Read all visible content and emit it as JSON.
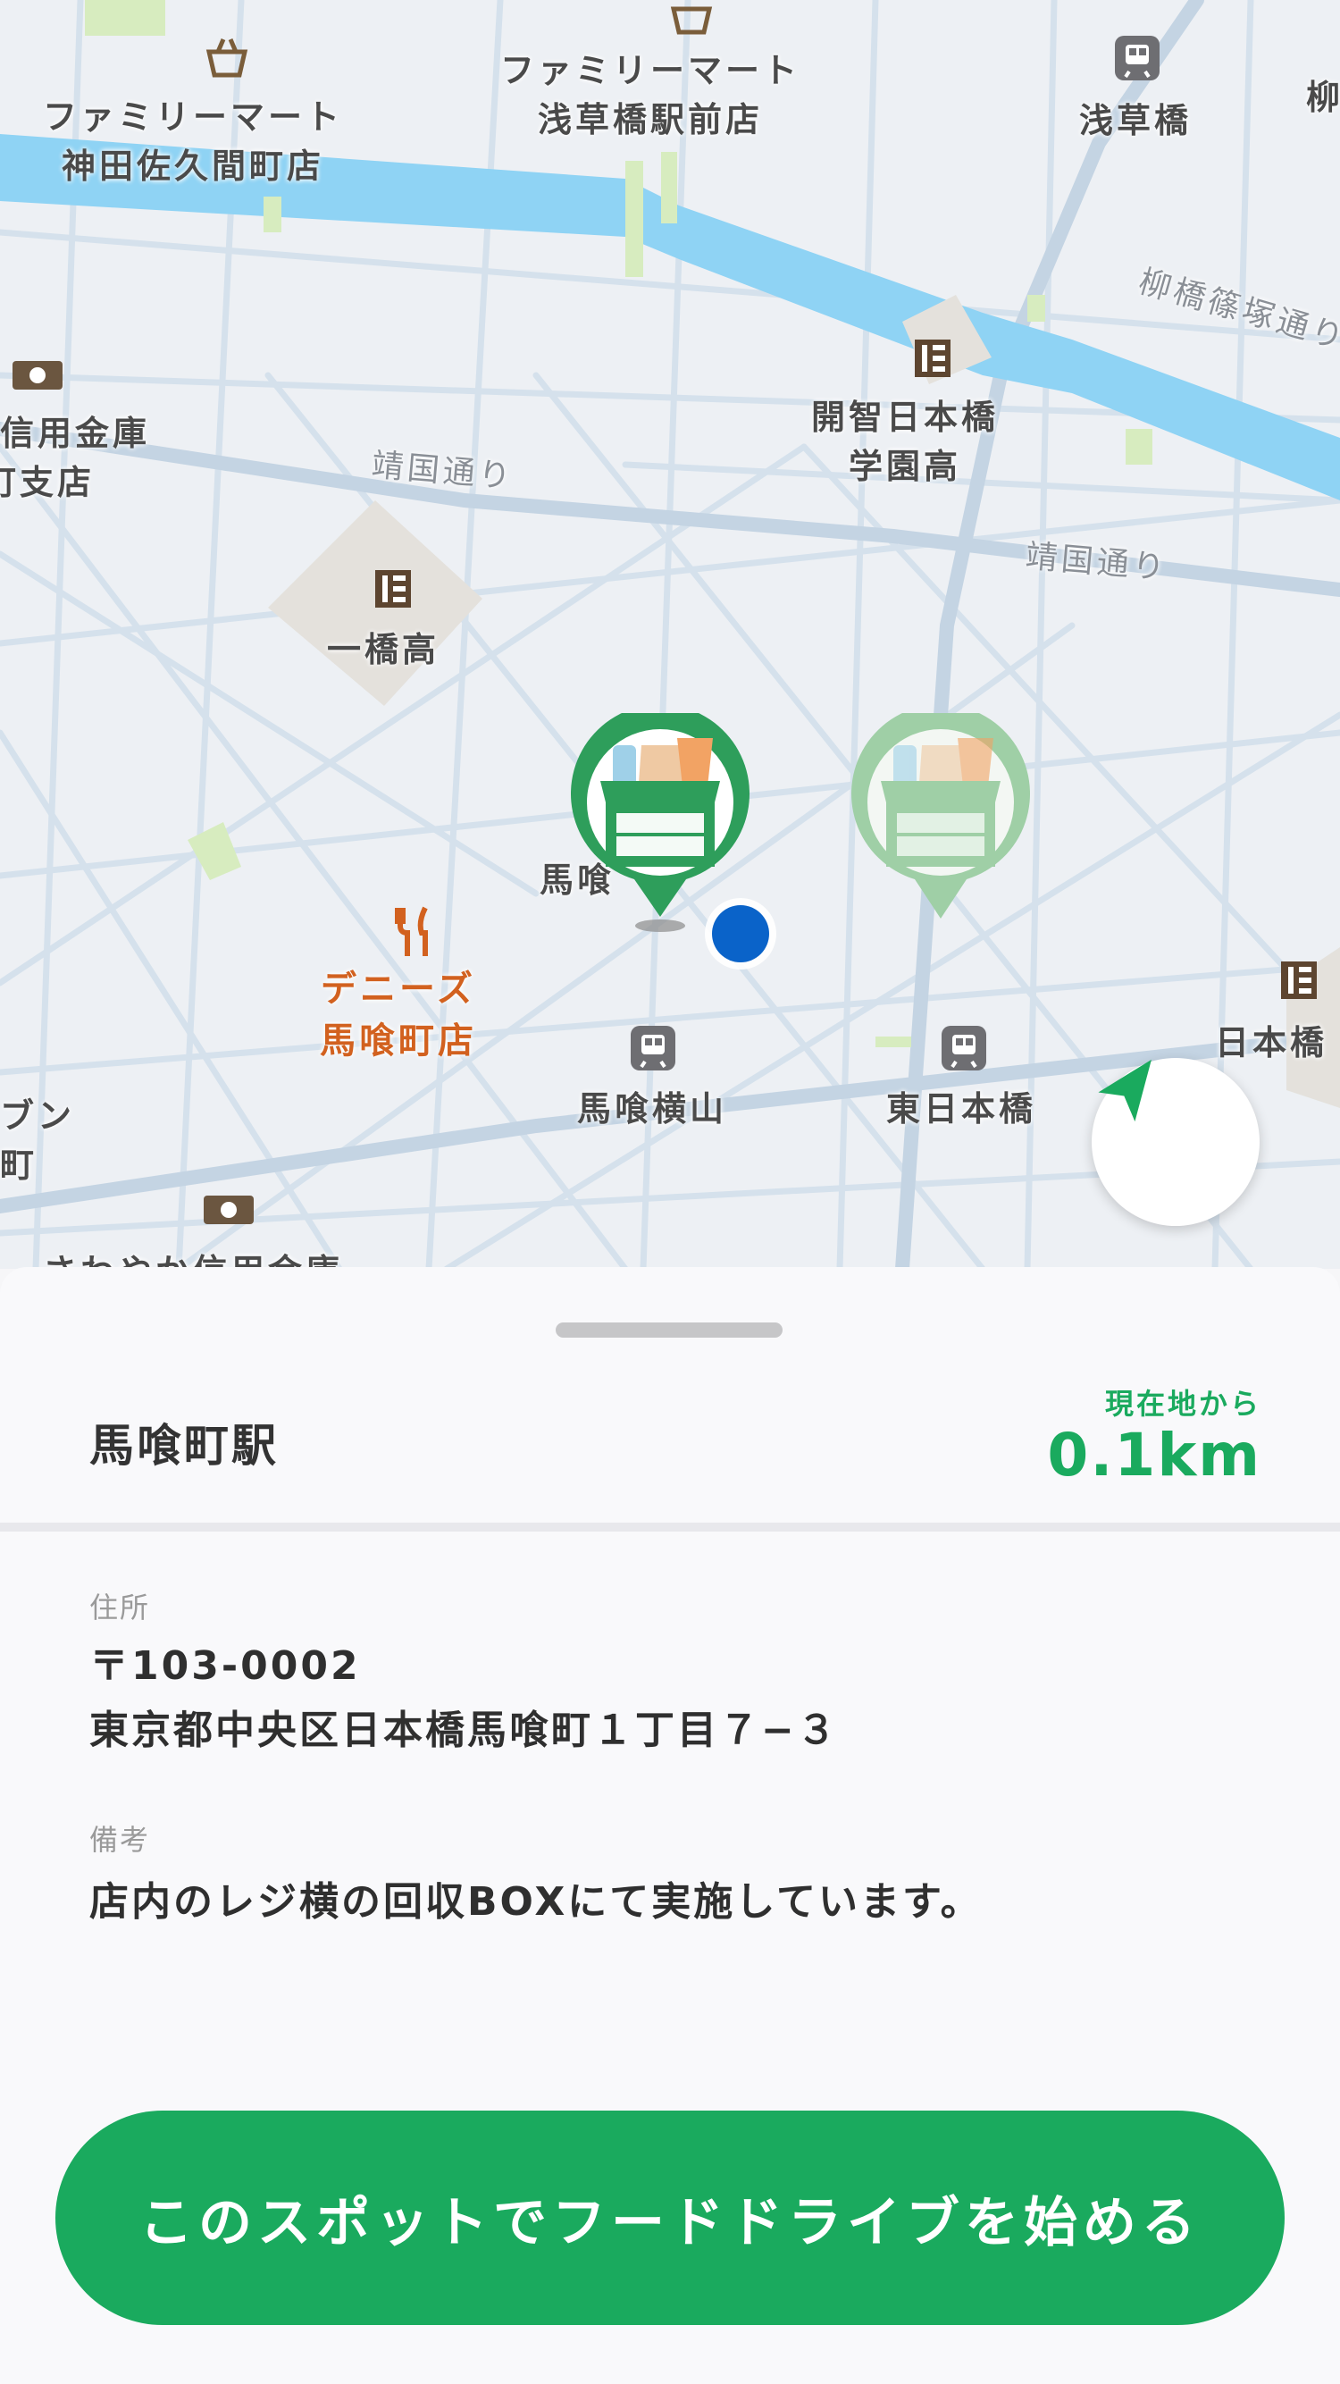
{
  "map": {
    "poi_labels": [
      {
        "id": "familymart-kanda",
        "lines": [
          "ファミリーマート",
          "神田佐久間町店"
        ]
      },
      {
        "id": "familymart-asakusabashi",
        "lines": [
          "ファミリーマート",
          "浅草橋駅前店"
        ]
      },
      {
        "id": "asakusabashi-station",
        "lines": [
          "浅草橋"
        ]
      },
      {
        "id": "bank-left",
        "lines": [
          "信用金庫",
          "町支店"
        ]
      },
      {
        "id": "kaichi-school",
        "lines": [
          "開智日本橋",
          "学園高"
        ]
      },
      {
        "id": "hitotsubashi-school",
        "lines": [
          "一橋高"
        ]
      },
      {
        "id": "bakurocho-partial",
        "lines": [
          "馬喰"
        ]
      },
      {
        "id": "bakuroyokoyama-station",
        "lines": [
          "馬喰横山"
        ]
      },
      {
        "id": "higashinihombashi-station",
        "lines": [
          "東日本橋"
        ]
      },
      {
        "id": "nihombashi-right",
        "lines": [
          "日本橋"
        ]
      },
      {
        "id": "left-edge-partial",
        "lines": [
          "ブン",
          "町"
        ]
      },
      {
        "id": "sawayaka-bank",
        "lines": [
          "さわやか信用金庫"
        ]
      },
      {
        "id": "yanagibashi-partial",
        "lines": [
          "柳"
        ]
      }
    ],
    "road_labels": [
      "靖国通り",
      "靖国通り",
      "柳橋篠塚通り"
    ],
    "restaurant_label": [
      "デニーズ",
      "馬喰町店"
    ],
    "colors": {
      "river": "#8fd3f4",
      "park": "#d7ecbf",
      "road": "#c9d9e8",
      "block": "#f3f5f8"
    }
  },
  "sheet": {
    "spot_name": "馬喰町駅",
    "distance_label": "現在地から",
    "distance_value": "0.1km",
    "address_label": "住所",
    "postal_code": "〒103-0002",
    "address": "東京都中央区日本橋馬喰町１丁目７−３",
    "notes_label": "備考",
    "notes": "店内のレジ横の回収BOXにて実施しています。",
    "start_button": "このスポットでフードドライブを始める"
  },
  "colors": {
    "accent": "#1aaa5e",
    "pin_active": "#2e9e5b",
    "pin_inactive": "#9fcfa6",
    "user_dot": "#0a63c9"
  }
}
